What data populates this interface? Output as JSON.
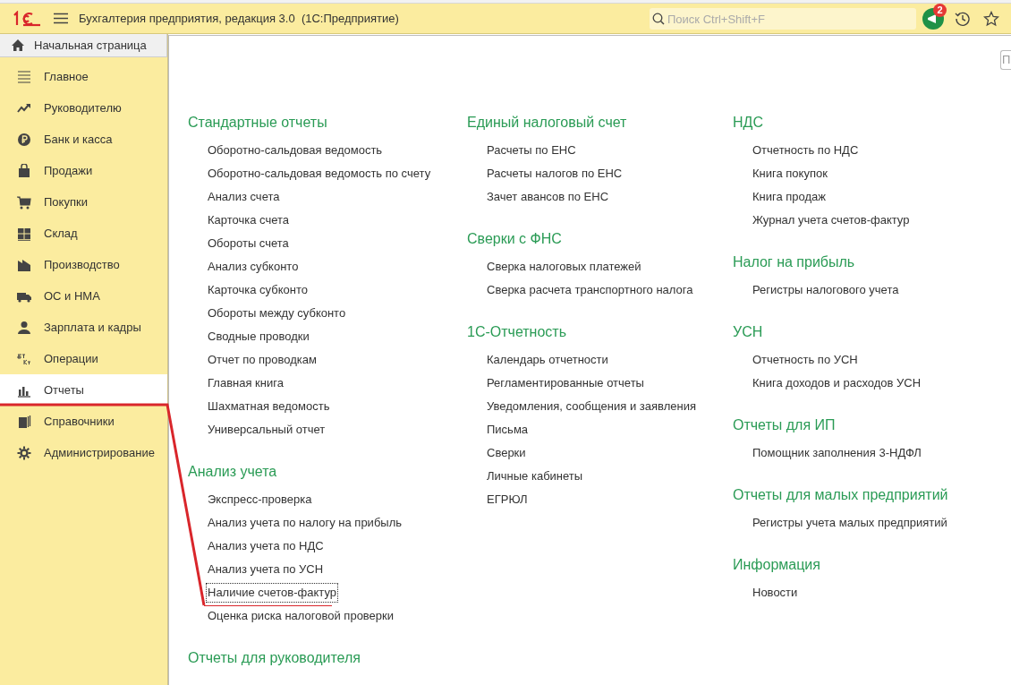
{
  "window": {
    "title": "Бухгалтерия предприятия, редакция 3.0  (1С:Предприятие)"
  },
  "search": {
    "placeholder": "Поиск Ctrl+Shift+F"
  },
  "notifications": {
    "count": "2"
  },
  "home_tab": {
    "label": "Начальная страница"
  },
  "sidebar": {
    "items": [
      {
        "label": "Главное",
        "kind": "menu",
        "selected": false
      },
      {
        "label": "Руководителю",
        "kind": "trend",
        "selected": false
      },
      {
        "label": "Банк и касса",
        "kind": "ruble",
        "selected": false
      },
      {
        "label": "Продажи",
        "kind": "bag",
        "selected": false
      },
      {
        "label": "Покупки",
        "kind": "cart",
        "selected": false
      },
      {
        "label": "Склад",
        "kind": "grid",
        "selected": false
      },
      {
        "label": "Производство",
        "kind": "factory",
        "selected": false
      },
      {
        "label": "ОС и НМА",
        "kind": "truck",
        "selected": false
      },
      {
        "label": "Зарплата и кадры",
        "kind": "person",
        "selected": false
      },
      {
        "label": "Операции",
        "kind": "dtkt",
        "selected": false
      },
      {
        "label": "Отчеты",
        "kind": "chart",
        "selected": true
      },
      {
        "label": "Справочники",
        "kind": "books",
        "selected": false
      },
      {
        "label": "Администрирование",
        "kind": "gear",
        "selected": false
      }
    ]
  },
  "corner_button": {
    "label": "П"
  },
  "columns": [
    [
      {
        "title": "Стандартные отчеты",
        "links": [
          {
            "label": "Оборотно-сальдовая ведомость",
            "focused": false
          },
          {
            "label": "Оборотно-сальдовая ведомость по счету",
            "focused": false
          },
          {
            "label": "Анализ счета",
            "focused": false
          },
          {
            "label": "Карточка счета",
            "focused": false
          },
          {
            "label": "Обороты счета",
            "focused": false
          },
          {
            "label": "Анализ субконто",
            "focused": false
          },
          {
            "label": "Карточка субконто",
            "focused": false
          },
          {
            "label": "Обороты между субконто",
            "focused": false
          },
          {
            "label": "Сводные проводки",
            "focused": false
          },
          {
            "label": "Отчет по проводкам",
            "focused": false
          },
          {
            "label": "Главная книга",
            "focused": false
          },
          {
            "label": "Шахматная ведомость",
            "focused": false
          },
          {
            "label": "Универсальный отчет",
            "focused": false
          }
        ]
      },
      {
        "title": "Анализ учета",
        "links": [
          {
            "label": "Экспресс-проверка",
            "focused": false
          },
          {
            "label": "Анализ учета по налогу на прибыль",
            "focused": false
          },
          {
            "label": "Анализ учета по НДС",
            "focused": false
          },
          {
            "label": "Анализ учета по УСН",
            "focused": false
          },
          {
            "label": "Наличие счетов-фактур",
            "focused": true
          },
          {
            "label": "Оценка риска налоговой проверки",
            "focused": false
          }
        ]
      },
      {
        "title": "Отчеты для руководителя"
      }
    ],
    [
      {
        "title": "Единый налоговый счет",
        "links": [
          {
            "label": "Расчеты по ЕНС",
            "focused": false
          },
          {
            "label": "Расчеты налогов по ЕНС",
            "focused": false
          },
          {
            "label": "Зачет авансов по ЕНС",
            "focused": false
          }
        ]
      },
      {
        "title": "Сверки с ФНС",
        "links": [
          {
            "label": "Сверка налоговых платежей",
            "focused": false
          },
          {
            "label": "Сверка расчета транспортного налога",
            "focused": false
          }
        ]
      },
      {
        "title": "1С-Отчетность",
        "links": [
          {
            "label": "Календарь отчетности",
            "focused": false
          },
          {
            "label": "Регламентированные отчеты",
            "focused": false
          },
          {
            "label": "Уведомления, сообщения и заявления",
            "focused": false
          },
          {
            "label": "Письма",
            "focused": false
          },
          {
            "label": "Сверки",
            "focused": false
          },
          {
            "label": "Личные кабинеты",
            "focused": false
          },
          {
            "label": "ЕГРЮЛ",
            "focused": false
          }
        ]
      }
    ],
    [
      {
        "title": "НДС",
        "links": [
          {
            "label": "Отчетность по НДС",
            "focused": false
          },
          {
            "label": "Книга покупок",
            "focused": false
          },
          {
            "label": "Книга продаж",
            "focused": false
          },
          {
            "label": "Журнал учета счетов-фактур",
            "focused": false
          }
        ]
      },
      {
        "title": "Налог на прибыль",
        "links": [
          {
            "label": "Регистры налогового учета",
            "focused": false
          }
        ]
      },
      {
        "title": "УСН",
        "links": [
          {
            "label": "Отчетность по УСН",
            "focused": false
          },
          {
            "label": "Книга доходов и расходов УСН",
            "focused": false
          }
        ]
      },
      {
        "title": "Отчеты для ИП",
        "links": [
          {
            "label": "Помощник заполнения 3-НДФЛ",
            "focused": false
          }
        ]
      },
      {
        "title": "Отчеты для малых предприятий",
        "links": [
          {
            "label": "Регистры учета малых предприятий",
            "focused": false
          }
        ]
      },
      {
        "title": "Информация",
        "links": [
          {
            "label": "Новости",
            "focused": false
          }
        ]
      }
    ]
  ]
}
